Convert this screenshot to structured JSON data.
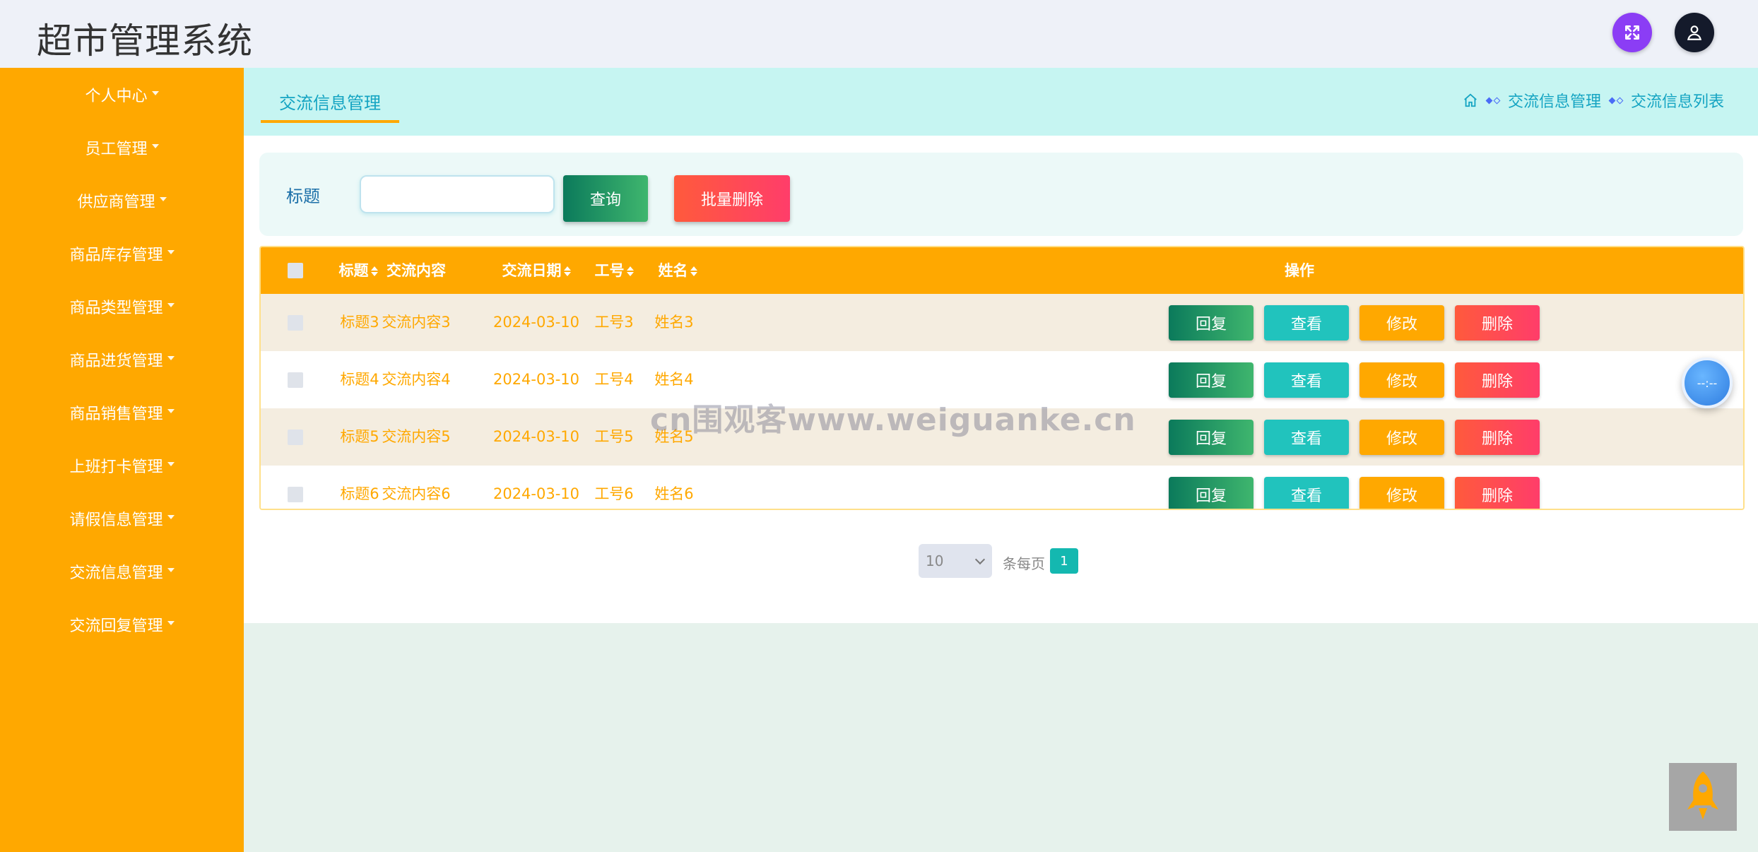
{
  "header": {
    "title": "超市管理系统"
  },
  "sidebar": {
    "items": [
      {
        "label": "个人中心"
      },
      {
        "label": "员工管理"
      },
      {
        "label": "供应商管理"
      },
      {
        "label": "商品库存管理"
      },
      {
        "label": "商品类型管理"
      },
      {
        "label": "商品进货管理"
      },
      {
        "label": "商品销售管理"
      },
      {
        "label": "上班打卡管理"
      },
      {
        "label": "请假信息管理"
      },
      {
        "label": "交流信息管理"
      },
      {
        "label": "交流回复管理"
      }
    ]
  },
  "page": {
    "tab_label": "交流信息管理",
    "breadcrumb": [
      "交流信息管理",
      "交流信息列表"
    ]
  },
  "search": {
    "label": "标题",
    "value": "",
    "query_button": "查询",
    "batch_delete_button": "批量删除"
  },
  "table": {
    "columns": [
      "标题",
      "交流内容",
      "交流日期",
      "工号",
      "姓名",
      "操作"
    ],
    "rows": [
      {
        "title": "标题3",
        "content": "交流内容3",
        "date": "2024-03-10",
        "emp_no": "工号3",
        "name": "姓名3"
      },
      {
        "title": "标题4",
        "content": "交流内容4",
        "date": "2024-03-10",
        "emp_no": "工号4",
        "name": "姓名4"
      },
      {
        "title": "标题5",
        "content": "交流内容5",
        "date": "2024-03-10",
        "emp_no": "工号5",
        "name": "姓名5"
      },
      {
        "title": "标题6",
        "content": "交流内容6",
        "date": "2024-03-10",
        "emp_no": "工号6",
        "name": "姓名6"
      }
    ],
    "actions": {
      "reply": "回复",
      "view": "查看",
      "edit": "修改",
      "delete": "删除"
    }
  },
  "pagination": {
    "page_size": "10",
    "per_page_label": "条每页",
    "current_page": "1"
  },
  "widgets": {
    "clock_text": "--:--",
    "watermark": "cn围观客www.weiguanke.cn"
  },
  "colors": {
    "accent": "#ffa800",
    "teal": "#14b8b0",
    "danger": "#ff4d4f",
    "success": "#0b7a5b"
  }
}
